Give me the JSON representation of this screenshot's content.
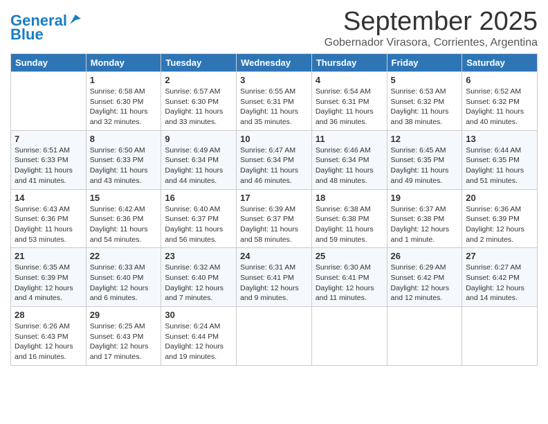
{
  "header": {
    "logo_line1": "General",
    "logo_line2": "Blue",
    "month_title": "September 2025",
    "subtitle": "Gobernador Virasora, Corrientes, Argentina"
  },
  "weekdays": [
    "Sunday",
    "Monday",
    "Tuesday",
    "Wednesday",
    "Thursday",
    "Friday",
    "Saturday"
  ],
  "weeks": [
    [
      {
        "day": "",
        "sunrise": "",
        "sunset": "",
        "daylight": ""
      },
      {
        "day": "1",
        "sunrise": "Sunrise: 6:58 AM",
        "sunset": "Sunset: 6:30 PM",
        "daylight": "Daylight: 11 hours and 32 minutes."
      },
      {
        "day": "2",
        "sunrise": "Sunrise: 6:57 AM",
        "sunset": "Sunset: 6:30 PM",
        "daylight": "Daylight: 11 hours and 33 minutes."
      },
      {
        "day": "3",
        "sunrise": "Sunrise: 6:55 AM",
        "sunset": "Sunset: 6:31 PM",
        "daylight": "Daylight: 11 hours and 35 minutes."
      },
      {
        "day": "4",
        "sunrise": "Sunrise: 6:54 AM",
        "sunset": "Sunset: 6:31 PM",
        "daylight": "Daylight: 11 hours and 36 minutes."
      },
      {
        "day": "5",
        "sunrise": "Sunrise: 6:53 AM",
        "sunset": "Sunset: 6:32 PM",
        "daylight": "Daylight: 11 hours and 38 minutes."
      },
      {
        "day": "6",
        "sunrise": "Sunrise: 6:52 AM",
        "sunset": "Sunset: 6:32 PM",
        "daylight": "Daylight: 11 hours and 40 minutes."
      }
    ],
    [
      {
        "day": "7",
        "sunrise": "Sunrise: 6:51 AM",
        "sunset": "Sunset: 6:33 PM",
        "daylight": "Daylight: 11 hours and 41 minutes."
      },
      {
        "day": "8",
        "sunrise": "Sunrise: 6:50 AM",
        "sunset": "Sunset: 6:33 PM",
        "daylight": "Daylight: 11 hours and 43 minutes."
      },
      {
        "day": "9",
        "sunrise": "Sunrise: 6:49 AM",
        "sunset": "Sunset: 6:34 PM",
        "daylight": "Daylight: 11 hours and 44 minutes."
      },
      {
        "day": "10",
        "sunrise": "Sunrise: 6:47 AM",
        "sunset": "Sunset: 6:34 PM",
        "daylight": "Daylight: 11 hours and 46 minutes."
      },
      {
        "day": "11",
        "sunrise": "Sunrise: 6:46 AM",
        "sunset": "Sunset: 6:34 PM",
        "daylight": "Daylight: 11 hours and 48 minutes."
      },
      {
        "day": "12",
        "sunrise": "Sunrise: 6:45 AM",
        "sunset": "Sunset: 6:35 PM",
        "daylight": "Daylight: 11 hours and 49 minutes."
      },
      {
        "day": "13",
        "sunrise": "Sunrise: 6:44 AM",
        "sunset": "Sunset: 6:35 PM",
        "daylight": "Daylight: 11 hours and 51 minutes."
      }
    ],
    [
      {
        "day": "14",
        "sunrise": "Sunrise: 6:43 AM",
        "sunset": "Sunset: 6:36 PM",
        "daylight": "Daylight: 11 hours and 53 minutes."
      },
      {
        "day": "15",
        "sunrise": "Sunrise: 6:42 AM",
        "sunset": "Sunset: 6:36 PM",
        "daylight": "Daylight: 11 hours and 54 minutes."
      },
      {
        "day": "16",
        "sunrise": "Sunrise: 6:40 AM",
        "sunset": "Sunset: 6:37 PM",
        "daylight": "Daylight: 11 hours and 56 minutes."
      },
      {
        "day": "17",
        "sunrise": "Sunrise: 6:39 AM",
        "sunset": "Sunset: 6:37 PM",
        "daylight": "Daylight: 11 hours and 58 minutes."
      },
      {
        "day": "18",
        "sunrise": "Sunrise: 6:38 AM",
        "sunset": "Sunset: 6:38 PM",
        "daylight": "Daylight: 11 hours and 59 minutes."
      },
      {
        "day": "19",
        "sunrise": "Sunrise: 6:37 AM",
        "sunset": "Sunset: 6:38 PM",
        "daylight": "Daylight: 12 hours and 1 minute."
      },
      {
        "day": "20",
        "sunrise": "Sunrise: 6:36 AM",
        "sunset": "Sunset: 6:39 PM",
        "daylight": "Daylight: 12 hours and 2 minutes."
      }
    ],
    [
      {
        "day": "21",
        "sunrise": "Sunrise: 6:35 AM",
        "sunset": "Sunset: 6:39 PM",
        "daylight": "Daylight: 12 hours and 4 minutes."
      },
      {
        "day": "22",
        "sunrise": "Sunrise: 6:33 AM",
        "sunset": "Sunset: 6:40 PM",
        "daylight": "Daylight: 12 hours and 6 minutes."
      },
      {
        "day": "23",
        "sunrise": "Sunrise: 6:32 AM",
        "sunset": "Sunset: 6:40 PM",
        "daylight": "Daylight: 12 hours and 7 minutes."
      },
      {
        "day": "24",
        "sunrise": "Sunrise: 6:31 AM",
        "sunset": "Sunset: 6:41 PM",
        "daylight": "Daylight: 12 hours and 9 minutes."
      },
      {
        "day": "25",
        "sunrise": "Sunrise: 6:30 AM",
        "sunset": "Sunset: 6:41 PM",
        "daylight": "Daylight: 12 hours and 11 minutes."
      },
      {
        "day": "26",
        "sunrise": "Sunrise: 6:29 AM",
        "sunset": "Sunset: 6:42 PM",
        "daylight": "Daylight: 12 hours and 12 minutes."
      },
      {
        "day": "27",
        "sunrise": "Sunrise: 6:27 AM",
        "sunset": "Sunset: 6:42 PM",
        "daylight": "Daylight: 12 hours and 14 minutes."
      }
    ],
    [
      {
        "day": "28",
        "sunrise": "Sunrise: 6:26 AM",
        "sunset": "Sunset: 6:43 PM",
        "daylight": "Daylight: 12 hours and 16 minutes."
      },
      {
        "day": "29",
        "sunrise": "Sunrise: 6:25 AM",
        "sunset": "Sunset: 6:43 PM",
        "daylight": "Daylight: 12 hours and 17 minutes."
      },
      {
        "day": "30",
        "sunrise": "Sunrise: 6:24 AM",
        "sunset": "Sunset: 6:44 PM",
        "daylight": "Daylight: 12 hours and 19 minutes."
      },
      {
        "day": "",
        "sunrise": "",
        "sunset": "",
        "daylight": ""
      },
      {
        "day": "",
        "sunrise": "",
        "sunset": "",
        "daylight": ""
      },
      {
        "day": "",
        "sunrise": "",
        "sunset": "",
        "daylight": ""
      },
      {
        "day": "",
        "sunrise": "",
        "sunset": "",
        "daylight": ""
      }
    ]
  ]
}
